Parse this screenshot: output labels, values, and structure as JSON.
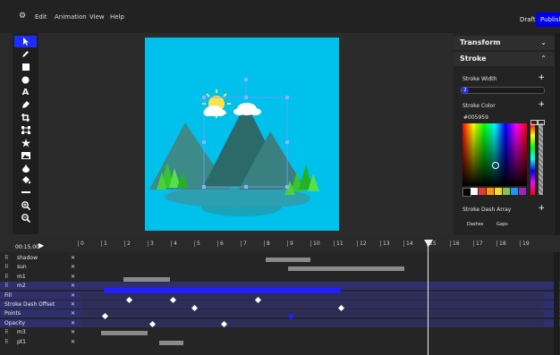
{
  "menu": {
    "logo_icon": "logo-icon",
    "items": [
      "Edit",
      "Animation",
      "View",
      "Help"
    ],
    "draft_label": "Draft",
    "publish_label": "Publish",
    "accent": "#0000ee"
  },
  "toolbar": {
    "tools": [
      "pointer",
      "pen",
      "rectangle",
      "ellipse",
      "text",
      "pen-nib",
      "crop",
      "transform-points",
      "star",
      "image",
      "fill",
      "paint-bucket",
      "line",
      "zoom-in",
      "zoom-out"
    ],
    "text_tool_glyph": "A"
  },
  "panel": {
    "transform_label": "Transform",
    "stroke_label": "Stroke",
    "stroke_width_label": "Stroke Width",
    "stroke_width_value": "2",
    "stroke_color_label": "Stroke Color",
    "stroke_color_value": "#005959",
    "stroke_dash_label": "Stroke Dash Array",
    "dashes_label": "Dashes",
    "gaps_label": "Gaps",
    "swatches": [
      "#ffffff",
      "#e53935",
      "#ff9800",
      "#fdd835",
      "#8bc34a",
      "#2196f3",
      "#9c27b0"
    ]
  },
  "timeline": {
    "time": "00:15.00",
    "ticks": [
      "0",
      "1",
      "2",
      "3",
      "4",
      "5",
      "6",
      "7",
      "8",
      "9",
      "10",
      "11",
      "12",
      "13",
      "14",
      "15",
      "16",
      "17",
      "18",
      "19"
    ],
    "rows": [
      {
        "label": "shadow",
        "type": "layer"
      },
      {
        "label": "sun",
        "type": "layer"
      },
      {
        "label": "m1",
        "type": "layer"
      },
      {
        "label": "m2",
        "type": "layer",
        "selected": true
      },
      {
        "label": "Fill",
        "type": "prop"
      },
      {
        "label": "Stroke Dash Offset",
        "type": "prop"
      },
      {
        "label": "Points",
        "type": "prop"
      },
      {
        "label": "Opacity",
        "type": "prop"
      },
      {
        "label": "m3",
        "type": "layer"
      },
      {
        "label": "pt1",
        "type": "layer"
      }
    ]
  }
}
